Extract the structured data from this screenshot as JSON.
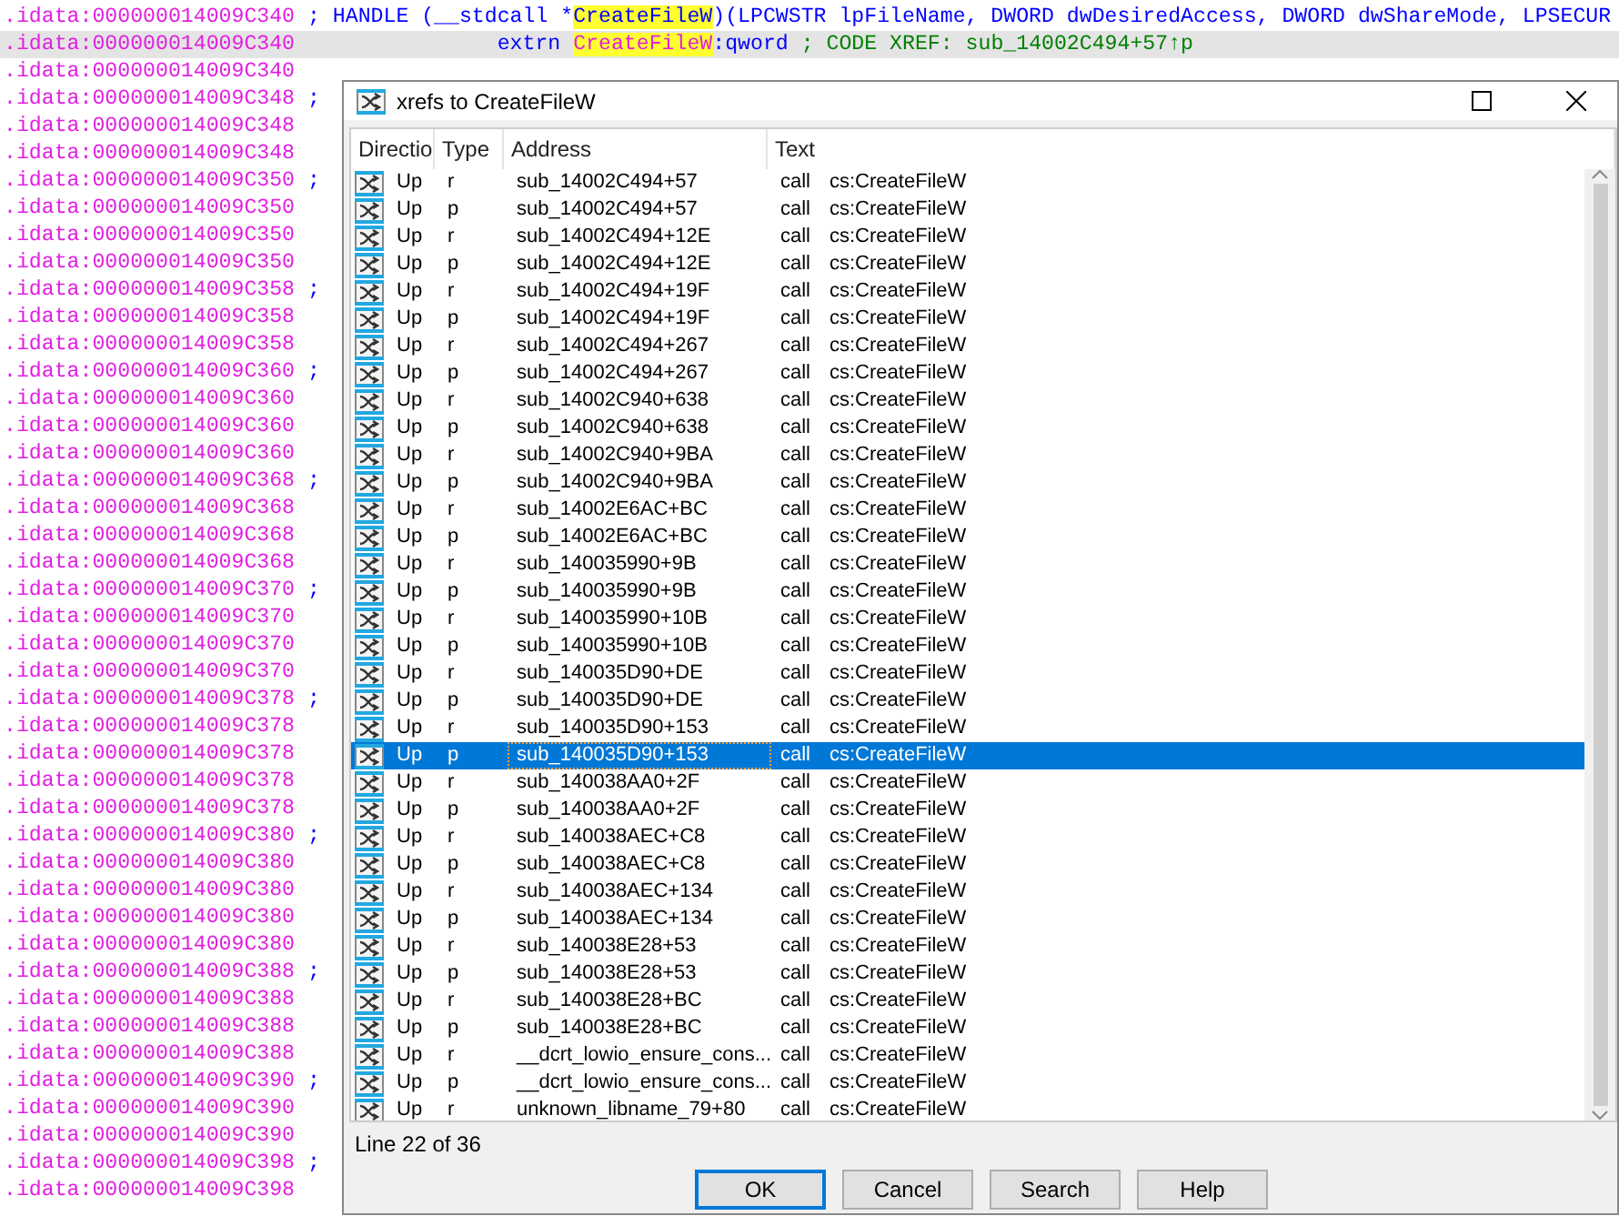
{
  "listing": [
    {
      "parts": [
        {
          "kind": "address",
          "text": ".idata:000000014009C340"
        },
        {
          "kind": "plain",
          "text": " ; HANDLE (__stdcall *"
        },
        {
          "kind": "highlight",
          "text": "CreateFileW"
        },
        {
          "kind": "plain",
          "text": ")(LPCWSTR lpFileName, DWORD dwDesiredAccess, DWORD dwShareMode, LPSECUR"
        }
      ],
      "selected": false
    },
    {
      "parts": [
        {
          "kind": "address",
          "text": ".idata:000000014009C340"
        },
        {
          "kind": "plain",
          "text": "                extrn "
        },
        {
          "kind": "name",
          "text": "CreateFileW"
        },
        {
          "kind": "plain",
          "text": ":qword"
        },
        {
          "kind": "comment",
          "text": " ; CODE XREF: sub_14002C494+57↑p"
        }
      ],
      "selected": true
    },
    {
      "parts": [
        {
          "kind": "address",
          "text": ".idata:000000014009C340"
        }
      ],
      "selected": false
    },
    {
      "parts": [
        {
          "kind": "address",
          "text": ".idata:000000014009C348"
        },
        {
          "kind": "plain",
          "text": " ;"
        }
      ],
      "selected": false
    },
    {
      "parts": [
        {
          "kind": "address",
          "text": ".idata:000000014009C348"
        }
      ],
      "selected": false
    },
    {
      "parts": [
        {
          "kind": "address",
          "text": ".idata:000000014009C348"
        }
      ],
      "selected": false
    },
    {
      "parts": [
        {
          "kind": "address",
          "text": ".idata:000000014009C350"
        },
        {
          "kind": "plain",
          "text": " ;"
        }
      ],
      "selected": false
    },
    {
      "parts": [
        {
          "kind": "address",
          "text": ".idata:000000014009C350"
        }
      ],
      "selected": false
    },
    {
      "parts": [
        {
          "kind": "address",
          "text": ".idata:000000014009C350"
        }
      ],
      "selected": false
    },
    {
      "parts": [
        {
          "kind": "address",
          "text": ".idata:000000014009C350"
        }
      ],
      "selected": false
    },
    {
      "parts": [
        {
          "kind": "address",
          "text": ".idata:000000014009C358"
        },
        {
          "kind": "plain",
          "text": " ;"
        }
      ],
      "selected": false
    },
    {
      "parts": [
        {
          "kind": "address",
          "text": ".idata:000000014009C358"
        }
      ],
      "selected": false
    },
    {
      "parts": [
        {
          "kind": "address",
          "text": ".idata:000000014009C358"
        }
      ],
      "selected": false
    },
    {
      "parts": [
        {
          "kind": "address",
          "text": ".idata:000000014009C360"
        },
        {
          "kind": "plain",
          "text": " ;"
        }
      ],
      "selected": false
    },
    {
      "parts": [
        {
          "kind": "address",
          "text": ".idata:000000014009C360"
        }
      ],
      "selected": false
    },
    {
      "parts": [
        {
          "kind": "address",
          "text": ".idata:000000014009C360"
        }
      ],
      "selected": false
    },
    {
      "parts": [
        {
          "kind": "address",
          "text": ".idata:000000014009C360"
        }
      ],
      "selected": false
    },
    {
      "parts": [
        {
          "kind": "address",
          "text": ".idata:000000014009C368"
        },
        {
          "kind": "plain",
          "text": " ;"
        }
      ],
      "selected": false
    },
    {
      "parts": [
        {
          "kind": "address",
          "text": ".idata:000000014009C368"
        }
      ],
      "selected": false
    },
    {
      "parts": [
        {
          "kind": "address",
          "text": ".idata:000000014009C368"
        }
      ],
      "selected": false
    },
    {
      "parts": [
        {
          "kind": "address",
          "text": ".idata:000000014009C368"
        }
      ],
      "selected": false
    },
    {
      "parts": [
        {
          "kind": "address",
          "text": ".idata:000000014009C370"
        },
        {
          "kind": "plain",
          "text": " ;"
        }
      ],
      "selected": false
    },
    {
      "parts": [
        {
          "kind": "address",
          "text": ".idata:000000014009C370"
        }
      ],
      "selected": false
    },
    {
      "parts": [
        {
          "kind": "address",
          "text": ".idata:000000014009C370"
        }
      ],
      "selected": false
    },
    {
      "parts": [
        {
          "kind": "address",
          "text": ".idata:000000014009C370"
        }
      ],
      "selected": false
    },
    {
      "parts": [
        {
          "kind": "address",
          "text": ".idata:000000014009C378"
        },
        {
          "kind": "plain",
          "text": " ;"
        }
      ],
      "selected": false
    },
    {
      "parts": [
        {
          "kind": "address",
          "text": ".idata:000000014009C378"
        }
      ],
      "selected": false
    },
    {
      "parts": [
        {
          "kind": "address",
          "text": ".idata:000000014009C378"
        }
      ],
      "selected": false
    },
    {
      "parts": [
        {
          "kind": "address",
          "text": ".idata:000000014009C378"
        }
      ],
      "selected": false
    },
    {
      "parts": [
        {
          "kind": "address",
          "text": ".idata:000000014009C378"
        }
      ],
      "selected": false
    },
    {
      "parts": [
        {
          "kind": "address",
          "text": ".idata:000000014009C380"
        },
        {
          "kind": "plain",
          "text": " ;"
        }
      ],
      "selected": false
    },
    {
      "parts": [
        {
          "kind": "address",
          "text": ".idata:000000014009C380"
        }
      ],
      "selected": false
    },
    {
      "parts": [
        {
          "kind": "address",
          "text": ".idata:000000014009C380"
        }
      ],
      "selected": false
    },
    {
      "parts": [
        {
          "kind": "address",
          "text": ".idata:000000014009C380"
        }
      ],
      "selected": false
    },
    {
      "parts": [
        {
          "kind": "address",
          "text": ".idata:000000014009C380"
        }
      ],
      "selected": false
    },
    {
      "parts": [
        {
          "kind": "address",
          "text": ".idata:000000014009C388"
        },
        {
          "kind": "plain",
          "text": " ;"
        }
      ],
      "selected": false
    },
    {
      "parts": [
        {
          "kind": "address",
          "text": ".idata:000000014009C388"
        }
      ],
      "selected": false
    },
    {
      "parts": [
        {
          "kind": "address",
          "text": ".idata:000000014009C388"
        }
      ],
      "selected": false
    },
    {
      "parts": [
        {
          "kind": "address",
          "text": ".idata:000000014009C388"
        }
      ],
      "selected": false
    },
    {
      "parts": [
        {
          "kind": "address",
          "text": ".idata:000000014009C390"
        },
        {
          "kind": "plain",
          "text": " ;"
        }
      ],
      "selected": false
    },
    {
      "parts": [
        {
          "kind": "address",
          "text": ".idata:000000014009C390"
        }
      ],
      "selected": false
    },
    {
      "parts": [
        {
          "kind": "address",
          "text": ".idata:000000014009C390"
        }
      ],
      "selected": false
    },
    {
      "parts": [
        {
          "kind": "address",
          "text": ".idata:000000014009C398"
        },
        {
          "kind": "plain",
          "text": " ;"
        }
      ],
      "selected": false
    },
    {
      "parts": [
        {
          "kind": "address",
          "text": ".idata:000000014009C398"
        }
      ],
      "selected": false
    }
  ],
  "dialog": {
    "title": "xrefs to CreateFileW",
    "columns": [
      "Directio",
      "Type",
      "Address",
      "Text"
    ],
    "rows": [
      {
        "direction": "Up",
        "type": "r",
        "address": "sub_14002C494+57",
        "instruction": "call",
        "operand": "cs:CreateFileW",
        "selected": false
      },
      {
        "direction": "Up",
        "type": "p",
        "address": "sub_14002C494+57",
        "instruction": "call",
        "operand": "cs:CreateFileW",
        "selected": false
      },
      {
        "direction": "Up",
        "type": "r",
        "address": "sub_14002C494+12E",
        "instruction": "call",
        "operand": "cs:CreateFileW",
        "selected": false
      },
      {
        "direction": "Up",
        "type": "p",
        "address": "sub_14002C494+12E",
        "instruction": "call",
        "operand": "cs:CreateFileW",
        "selected": false
      },
      {
        "direction": "Up",
        "type": "r",
        "address": "sub_14002C494+19F",
        "instruction": "call",
        "operand": "cs:CreateFileW",
        "selected": false
      },
      {
        "direction": "Up",
        "type": "p",
        "address": "sub_14002C494+19F",
        "instruction": "call",
        "operand": "cs:CreateFileW",
        "selected": false
      },
      {
        "direction": "Up",
        "type": "r",
        "address": "sub_14002C494+267",
        "instruction": "call",
        "operand": "cs:CreateFileW",
        "selected": false
      },
      {
        "direction": "Up",
        "type": "p",
        "address": "sub_14002C494+267",
        "instruction": "call",
        "operand": "cs:CreateFileW",
        "selected": false
      },
      {
        "direction": "Up",
        "type": "r",
        "address": "sub_14002C940+638",
        "instruction": "call",
        "operand": "cs:CreateFileW",
        "selected": false
      },
      {
        "direction": "Up",
        "type": "p",
        "address": "sub_14002C940+638",
        "instruction": "call",
        "operand": "cs:CreateFileW",
        "selected": false
      },
      {
        "direction": "Up",
        "type": "r",
        "address": "sub_14002C940+9BA",
        "instruction": "call",
        "operand": "cs:CreateFileW",
        "selected": false
      },
      {
        "direction": "Up",
        "type": "p",
        "address": "sub_14002C940+9BA",
        "instruction": "call",
        "operand": "cs:CreateFileW",
        "selected": false
      },
      {
        "direction": "Up",
        "type": "r",
        "address": "sub_14002E6AC+BC",
        "instruction": "call",
        "operand": "cs:CreateFileW",
        "selected": false
      },
      {
        "direction": "Up",
        "type": "p",
        "address": "sub_14002E6AC+BC",
        "instruction": "call",
        "operand": "cs:CreateFileW",
        "selected": false
      },
      {
        "direction": "Up",
        "type": "r",
        "address": "sub_140035990+9B",
        "instruction": "call",
        "operand": "cs:CreateFileW",
        "selected": false
      },
      {
        "direction": "Up",
        "type": "p",
        "address": "sub_140035990+9B",
        "instruction": "call",
        "operand": "cs:CreateFileW",
        "selected": false
      },
      {
        "direction": "Up",
        "type": "r",
        "address": "sub_140035990+10B",
        "instruction": "call",
        "operand": "cs:CreateFileW",
        "selected": false
      },
      {
        "direction": "Up",
        "type": "p",
        "address": "sub_140035990+10B",
        "instruction": "call",
        "operand": "cs:CreateFileW",
        "selected": false
      },
      {
        "direction": "Up",
        "type": "r",
        "address": "sub_140035D90+DE",
        "instruction": "call",
        "operand": "cs:CreateFileW",
        "selected": false
      },
      {
        "direction": "Up",
        "type": "p",
        "address": "sub_140035D90+DE",
        "instruction": "call",
        "operand": "cs:CreateFileW",
        "selected": false
      },
      {
        "direction": "Up",
        "type": "r",
        "address": "sub_140035D90+153",
        "instruction": "call",
        "operand": "cs:CreateFileW",
        "selected": false
      },
      {
        "direction": "Up",
        "type": "p",
        "address": "sub_140035D90+153",
        "instruction": "call",
        "operand": "cs:CreateFileW",
        "selected": true
      },
      {
        "direction": "Up",
        "type": "r",
        "address": "sub_140038AA0+2F",
        "instruction": "call",
        "operand": "cs:CreateFileW",
        "selected": false
      },
      {
        "direction": "Up",
        "type": "p",
        "address": "sub_140038AA0+2F",
        "instruction": "call",
        "operand": "cs:CreateFileW",
        "selected": false
      },
      {
        "direction": "Up",
        "type": "r",
        "address": "sub_140038AEC+C8",
        "instruction": "call",
        "operand": "cs:CreateFileW",
        "selected": false
      },
      {
        "direction": "Up",
        "type": "p",
        "address": "sub_140038AEC+C8",
        "instruction": "call",
        "operand": "cs:CreateFileW",
        "selected": false
      },
      {
        "direction": "Up",
        "type": "r",
        "address": "sub_140038AEC+134",
        "instruction": "call",
        "operand": "cs:CreateFileW",
        "selected": false
      },
      {
        "direction": "Up",
        "type": "p",
        "address": "sub_140038AEC+134",
        "instruction": "call",
        "operand": "cs:CreateFileW",
        "selected": false
      },
      {
        "direction": "Up",
        "type": "r",
        "address": "sub_140038E28+53",
        "instruction": "call",
        "operand": "cs:CreateFileW",
        "selected": false
      },
      {
        "direction": "Up",
        "type": "p",
        "address": "sub_140038E28+53",
        "instruction": "call",
        "operand": "cs:CreateFileW",
        "selected": false
      },
      {
        "direction": "Up",
        "type": "r",
        "address": "sub_140038E28+BC",
        "instruction": "call",
        "operand": "cs:CreateFileW",
        "selected": false
      },
      {
        "direction": "Up",
        "type": "p",
        "address": "sub_140038E28+BC",
        "instruction": "call",
        "operand": "cs:CreateFileW",
        "selected": false
      },
      {
        "direction": "Up",
        "type": "r",
        "address": "__dcrt_lowio_ensure_cons...",
        "instruction": "call",
        "operand": "cs:CreateFileW",
        "selected": false
      },
      {
        "direction": "Up",
        "type": "p",
        "address": "__dcrt_lowio_ensure_cons...",
        "instruction": "call",
        "operand": "cs:CreateFileW",
        "selected": false
      },
      {
        "direction": "Up",
        "type": "r",
        "address": "unknown_libname_79+80",
        "instruction": "call",
        "operand": "cs:CreateFileW",
        "selected": false
      }
    ],
    "status": "Line 22 of 36",
    "buttons": [
      {
        "label": "OK",
        "default": true
      },
      {
        "label": "Cancel",
        "default": false
      },
      {
        "label": "Search",
        "default": false
      },
      {
        "label": "Help",
        "default": false
      }
    ]
  }
}
